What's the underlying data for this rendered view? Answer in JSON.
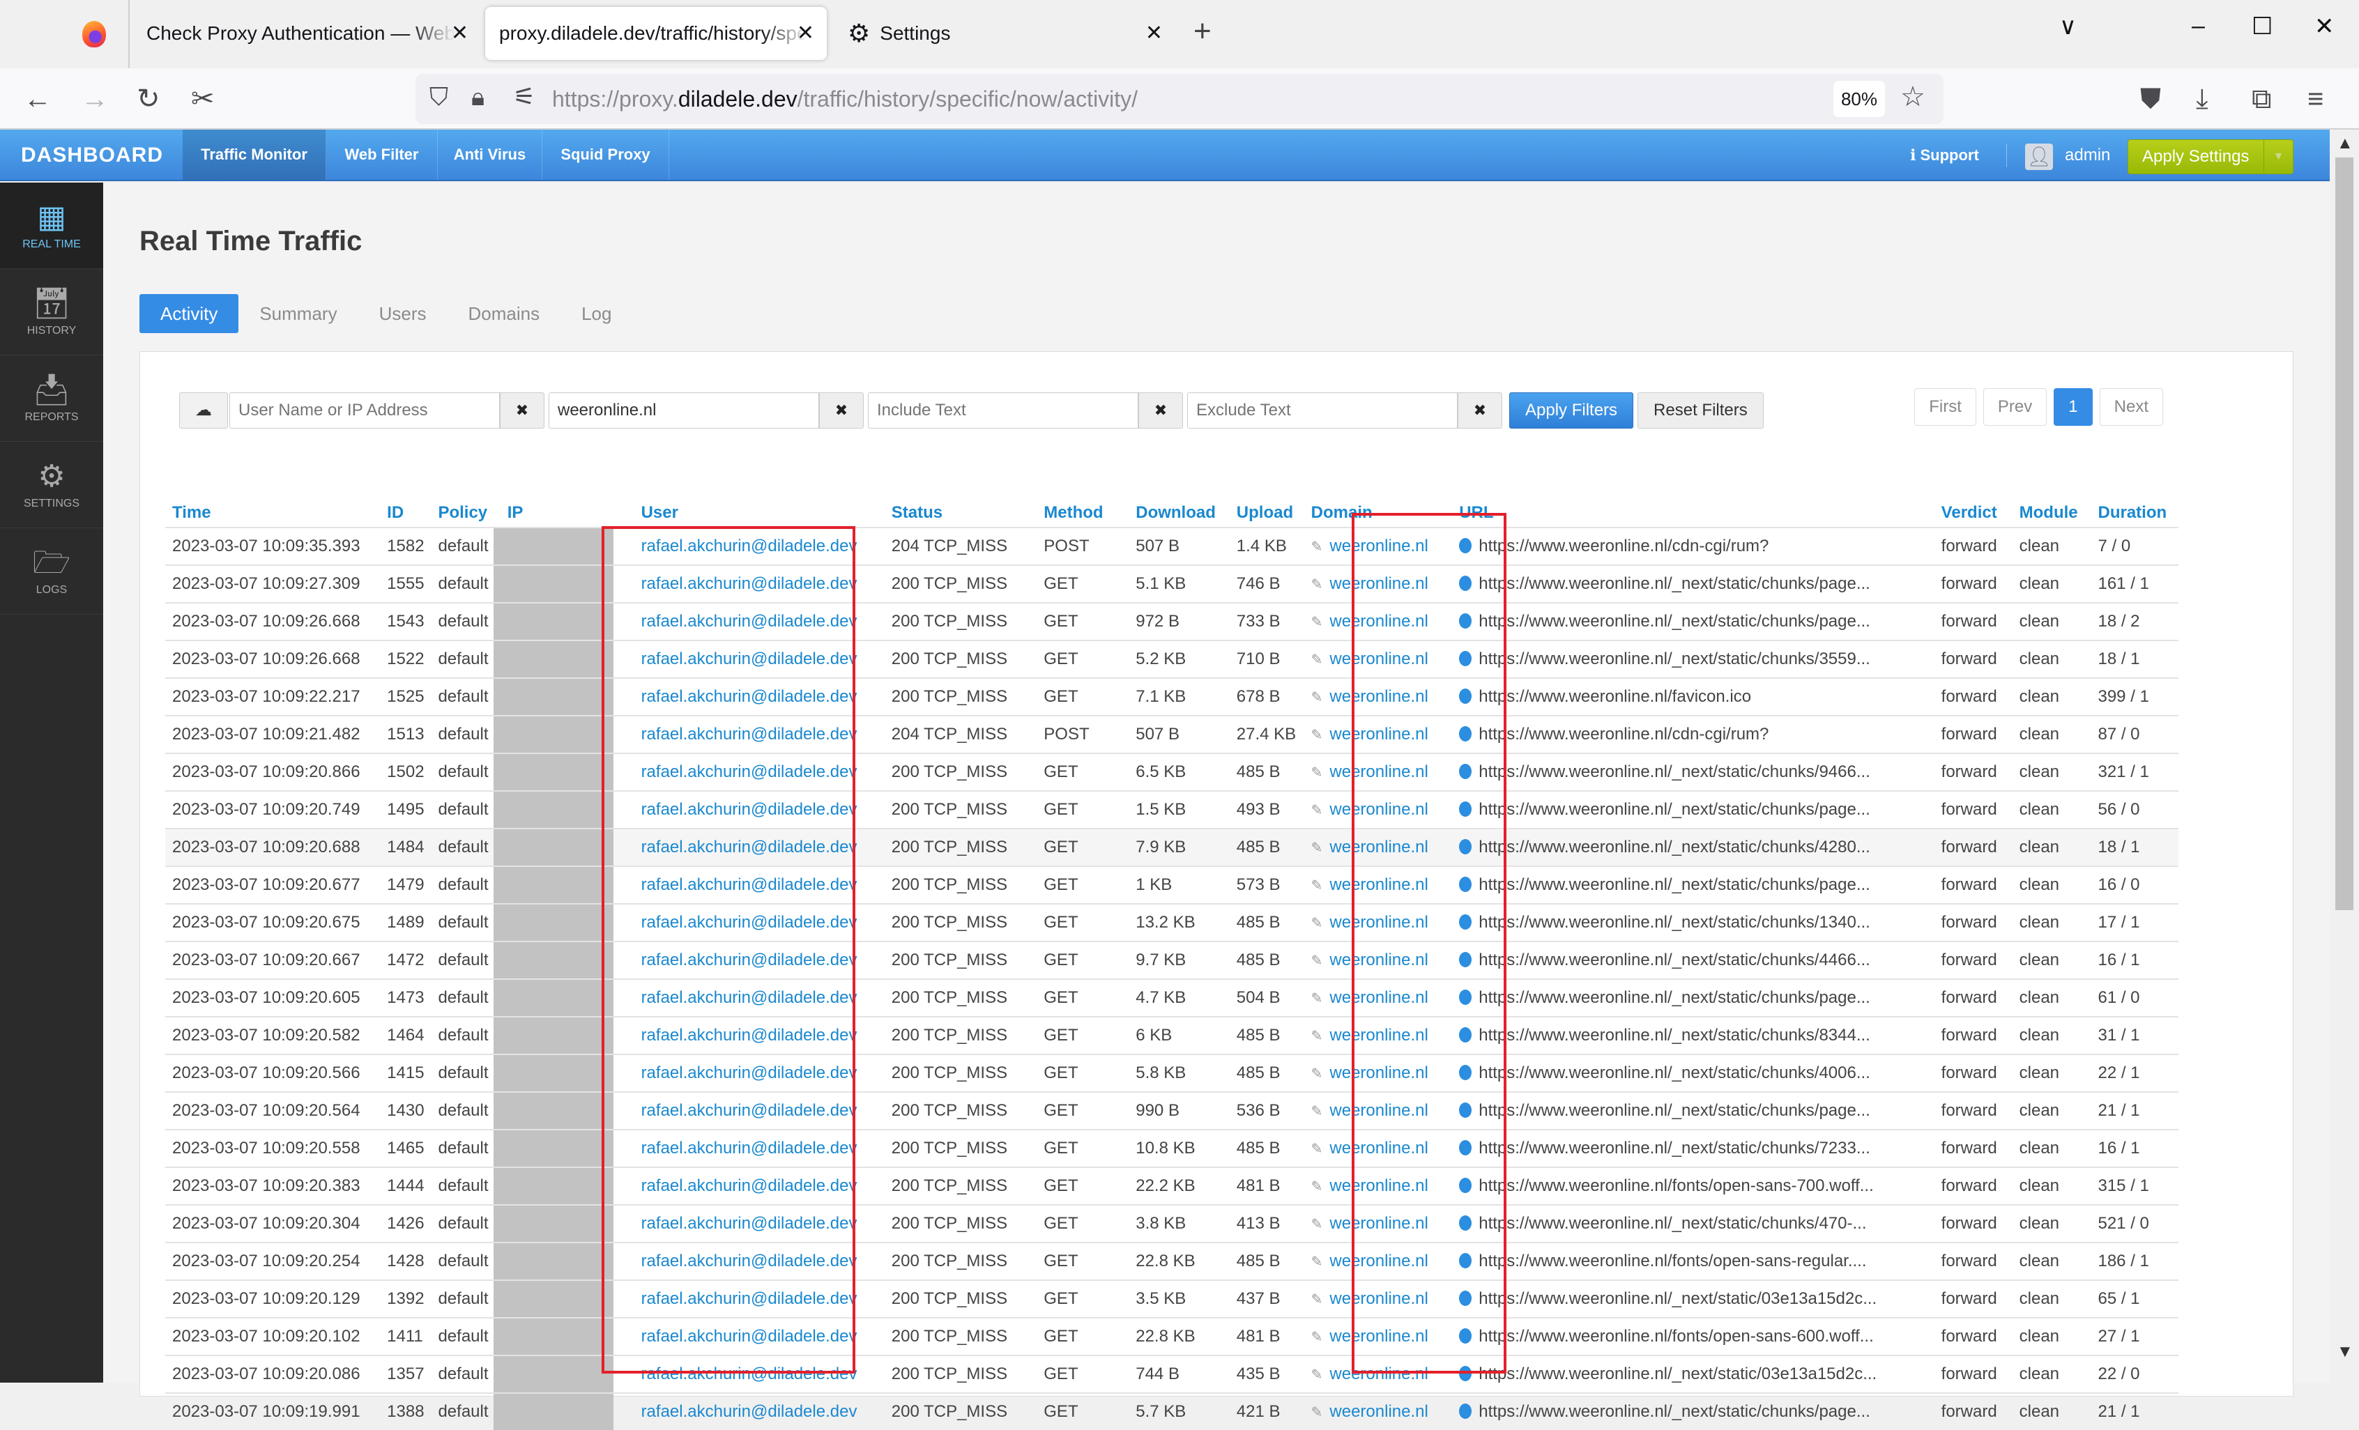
{
  "browser": {
    "tabs": [
      {
        "title": "Check Proxy Authentication — Web",
        "active": false
      },
      {
        "title": "proxy.diladele.dev/traffic/history/spe",
        "active": true
      },
      {
        "title": "Settings",
        "icon": "gear-icon",
        "active": false
      }
    ],
    "new_tab_label": "+",
    "url_prefix": "https://proxy.",
    "url_domain": "diladele.dev",
    "url_path": "/traffic/history/specific/now/activity/",
    "zoom": "80%",
    "window_controls": {
      "minimize": "–",
      "maximize": "☐",
      "close": "✕",
      "tab_list": "∨"
    }
  },
  "app": {
    "brand": "DASHBOARD",
    "nav": [
      {
        "label": "Traffic Monitor",
        "active": true
      },
      {
        "label": "Web Filter",
        "active": false
      },
      {
        "label": "Anti Virus",
        "active": false
      },
      {
        "label": "Squid Proxy",
        "active": false
      }
    ],
    "support_label": "Support",
    "user_label": "admin",
    "apply_settings_label": "Apply Settings"
  },
  "sidebar": {
    "items": [
      {
        "label": "REAL TIME",
        "icon": "grid-icon",
        "active": true
      },
      {
        "label": "HISTORY",
        "icon": "calendar-icon",
        "active": false
      },
      {
        "label": "REPORTS",
        "icon": "inbox-icon",
        "active": false
      },
      {
        "label": "SETTINGS",
        "icon": "gear-icon",
        "active": false
      },
      {
        "label": "LOGS",
        "icon": "folder-icon",
        "active": false
      }
    ]
  },
  "page": {
    "title": "Real Time Traffic",
    "tabs": [
      {
        "label": "Activity",
        "active": true
      },
      {
        "label": "Summary",
        "active": false
      },
      {
        "label": "Users",
        "active": false
      },
      {
        "label": "Domains",
        "active": false
      },
      {
        "label": "Log",
        "active": false
      }
    ]
  },
  "filters": {
    "user": {
      "value": "",
      "placeholder": "User Name or IP Address"
    },
    "domain": {
      "value": "weeronline.nl",
      "placeholder": ""
    },
    "include": {
      "value": "",
      "placeholder": "Include Text"
    },
    "exclude": {
      "value": "",
      "placeholder": "Exclude Text"
    },
    "clear_label": "✖",
    "apply_label": "Apply Filters",
    "reset_label": "Reset Filters"
  },
  "pagination": {
    "first": "First",
    "prev": "Prev",
    "current": "1",
    "next": "Next"
  },
  "table": {
    "columns": [
      "Time",
      "ID",
      "Policy",
      "IP",
      "User",
      "Status",
      "Method",
      "Download",
      "Upload",
      "Domain",
      "URL",
      "Verdict",
      "Module",
      "Duration"
    ],
    "rows": [
      {
        "time": "2023-03-07 10:09:35.393",
        "id": "1582",
        "policy": "default",
        "ip": "",
        "user": "rafael.akchurin@diladele.dev",
        "status": "204 TCP_MISS",
        "method": "POST",
        "download": "507 B",
        "upload": "1.4 KB",
        "domain": "weeronline.nl",
        "url": "https://www.weeronline.nl/cdn-cgi/rum?",
        "verdict": "forward",
        "module": "clean",
        "duration": "7 / 0"
      },
      {
        "time": "2023-03-07 10:09:27.309",
        "id": "1555",
        "policy": "default",
        "ip": "",
        "user": "rafael.akchurin@diladele.dev",
        "status": "200 TCP_MISS",
        "method": "GET",
        "download": "5.1 KB",
        "upload": "746 B",
        "domain": "weeronline.nl",
        "url": "https://www.weeronline.nl/_next/static/chunks/page...",
        "verdict": "forward",
        "module": "clean",
        "duration": "161 / 1"
      },
      {
        "time": "2023-03-07 10:09:26.668",
        "id": "1543",
        "policy": "default",
        "ip": "",
        "user": "rafael.akchurin@diladele.dev",
        "status": "200 TCP_MISS",
        "method": "GET",
        "download": "972 B",
        "upload": "733 B",
        "domain": "weeronline.nl",
        "url": "https://www.weeronline.nl/_next/static/chunks/page...",
        "verdict": "forward",
        "module": "clean",
        "duration": "18 / 2"
      },
      {
        "time": "2023-03-07 10:09:26.668",
        "id": "1522",
        "policy": "default",
        "ip": "",
        "user": "rafael.akchurin@diladele.dev",
        "status": "200 TCP_MISS",
        "method": "GET",
        "download": "5.2 KB",
        "upload": "710 B",
        "domain": "weeronline.nl",
        "url": "https://www.weeronline.nl/_next/static/chunks/3559...",
        "verdict": "forward",
        "module": "clean",
        "duration": "18 / 1"
      },
      {
        "time": "2023-03-07 10:09:22.217",
        "id": "1525",
        "policy": "default",
        "ip": "",
        "user": "rafael.akchurin@diladele.dev",
        "status": "200 TCP_MISS",
        "method": "GET",
        "download": "7.1 KB",
        "upload": "678 B",
        "domain": "weeronline.nl",
        "url": "https://www.weeronline.nl/favicon.ico",
        "verdict": "forward",
        "module": "clean",
        "duration": "399 / 1"
      },
      {
        "time": "2023-03-07 10:09:21.482",
        "id": "1513",
        "policy": "default",
        "ip": "",
        "user": "rafael.akchurin@diladele.dev",
        "status": "204 TCP_MISS",
        "method": "POST",
        "download": "507 B",
        "upload": "27.4 KB",
        "domain": "weeronline.nl",
        "url": "https://www.weeronline.nl/cdn-cgi/rum?",
        "verdict": "forward",
        "module": "clean",
        "duration": "87 / 0"
      },
      {
        "time": "2023-03-07 10:09:20.866",
        "id": "1502",
        "policy": "default",
        "ip": "",
        "user": "rafael.akchurin@diladele.dev",
        "status": "200 TCP_MISS",
        "method": "GET",
        "download": "6.5 KB",
        "upload": "485 B",
        "domain": "weeronline.nl",
        "url": "https://www.weeronline.nl/_next/static/chunks/9466...",
        "verdict": "forward",
        "module": "clean",
        "duration": "321 / 1"
      },
      {
        "time": "2023-03-07 10:09:20.749",
        "id": "1495",
        "policy": "default",
        "ip": "",
        "user": "rafael.akchurin@diladele.dev",
        "status": "200 TCP_MISS",
        "method": "GET",
        "download": "1.5 KB",
        "upload": "493 B",
        "domain": "weeronline.nl",
        "url": "https://www.weeronline.nl/_next/static/chunks/page...",
        "verdict": "forward",
        "module": "clean",
        "duration": "56 / 0"
      },
      {
        "time": "2023-03-07 10:09:20.688",
        "id": "1484",
        "policy": "default",
        "ip": "",
        "user": "rafael.akchurin@diladele.dev",
        "status": "200 TCP_MISS",
        "method": "GET",
        "download": "7.9 KB",
        "upload": "485 B",
        "domain": "weeronline.nl",
        "url": "https://www.weeronline.nl/_next/static/chunks/4280...",
        "verdict": "forward",
        "module": "clean",
        "duration": "18 / 1",
        "highlighted": true
      },
      {
        "time": "2023-03-07 10:09:20.677",
        "id": "1479",
        "policy": "default",
        "ip": "",
        "user": "rafael.akchurin@diladele.dev",
        "status": "200 TCP_MISS",
        "method": "GET",
        "download": "1 KB",
        "upload": "573 B",
        "domain": "weeronline.nl",
        "url": "https://www.weeronline.nl/_next/static/chunks/page...",
        "verdict": "forward",
        "module": "clean",
        "duration": "16 / 0"
      },
      {
        "time": "2023-03-07 10:09:20.675",
        "id": "1489",
        "policy": "default",
        "ip": "",
        "user": "rafael.akchurin@diladele.dev",
        "status": "200 TCP_MISS",
        "method": "GET",
        "download": "13.2 KB",
        "upload": "485 B",
        "domain": "weeronline.nl",
        "url": "https://www.weeronline.nl/_next/static/chunks/1340...",
        "verdict": "forward",
        "module": "clean",
        "duration": "17 / 1"
      },
      {
        "time": "2023-03-07 10:09:20.667",
        "id": "1472",
        "policy": "default",
        "ip": "",
        "user": "rafael.akchurin@diladele.dev",
        "status": "200 TCP_MISS",
        "method": "GET",
        "download": "9.7 KB",
        "upload": "485 B",
        "domain": "weeronline.nl",
        "url": "https://www.weeronline.nl/_next/static/chunks/4466...",
        "verdict": "forward",
        "module": "clean",
        "duration": "16 / 1"
      },
      {
        "time": "2023-03-07 10:09:20.605",
        "id": "1473",
        "policy": "default",
        "ip": "",
        "user": "rafael.akchurin@diladele.dev",
        "status": "200 TCP_MISS",
        "method": "GET",
        "download": "4.7 KB",
        "upload": "504 B",
        "domain": "weeronline.nl",
        "url": "https://www.weeronline.nl/_next/static/chunks/page...",
        "verdict": "forward",
        "module": "clean",
        "duration": "61 / 0"
      },
      {
        "time": "2023-03-07 10:09:20.582",
        "id": "1464",
        "policy": "default",
        "ip": "",
        "user": "rafael.akchurin@diladele.dev",
        "status": "200 TCP_MISS",
        "method": "GET",
        "download": "6 KB",
        "upload": "485 B",
        "domain": "weeronline.nl",
        "url": "https://www.weeronline.nl/_next/static/chunks/8344...",
        "verdict": "forward",
        "module": "clean",
        "duration": "31 / 1"
      },
      {
        "time": "2023-03-07 10:09:20.566",
        "id": "1415",
        "policy": "default",
        "ip": "",
        "user": "rafael.akchurin@diladele.dev",
        "status": "200 TCP_MISS",
        "method": "GET",
        "download": "5.8 KB",
        "upload": "485 B",
        "domain": "weeronline.nl",
        "url": "https://www.weeronline.nl/_next/static/chunks/4006...",
        "verdict": "forward",
        "module": "clean",
        "duration": "22 / 1"
      },
      {
        "time": "2023-03-07 10:09:20.564",
        "id": "1430",
        "policy": "default",
        "ip": "",
        "user": "rafael.akchurin@diladele.dev",
        "status": "200 TCP_MISS",
        "method": "GET",
        "download": "990 B",
        "upload": "536 B",
        "domain": "weeronline.nl",
        "url": "https://www.weeronline.nl/_next/static/chunks/page...",
        "verdict": "forward",
        "module": "clean",
        "duration": "21 / 1"
      },
      {
        "time": "2023-03-07 10:09:20.558",
        "id": "1465",
        "policy": "default",
        "ip": "",
        "user": "rafael.akchurin@diladele.dev",
        "status": "200 TCP_MISS",
        "method": "GET",
        "download": "10.8 KB",
        "upload": "485 B",
        "domain": "weeronline.nl",
        "url": "https://www.weeronline.nl/_next/static/chunks/7233...",
        "verdict": "forward",
        "module": "clean",
        "duration": "16 / 1"
      },
      {
        "time": "2023-03-07 10:09:20.383",
        "id": "1444",
        "policy": "default",
        "ip": "",
        "user": "rafael.akchurin@diladele.dev",
        "status": "200 TCP_MISS",
        "method": "GET",
        "download": "22.2 KB",
        "upload": "481 B",
        "domain": "weeronline.nl",
        "url": "https://www.weeronline.nl/fonts/open-sans-700.woff...",
        "verdict": "forward",
        "module": "clean",
        "duration": "315 / 1"
      },
      {
        "time": "2023-03-07 10:09:20.304",
        "id": "1426",
        "policy": "default",
        "ip": "",
        "user": "rafael.akchurin@diladele.dev",
        "status": "200 TCP_MISS",
        "method": "GET",
        "download": "3.8 KB",
        "upload": "413 B",
        "domain": "weeronline.nl",
        "url": "https://www.weeronline.nl/_next/static/chunks/470-...",
        "verdict": "forward",
        "module": "clean",
        "duration": "521 / 0"
      },
      {
        "time": "2023-03-07 10:09:20.254",
        "id": "1428",
        "policy": "default",
        "ip": "",
        "user": "rafael.akchurin@diladele.dev",
        "status": "200 TCP_MISS",
        "method": "GET",
        "download": "22.8 KB",
        "upload": "485 B",
        "domain": "weeronline.nl",
        "url": "https://www.weeronline.nl/fonts/open-sans-regular....",
        "verdict": "forward",
        "module": "clean",
        "duration": "186 / 1"
      },
      {
        "time": "2023-03-07 10:09:20.129",
        "id": "1392",
        "policy": "default",
        "ip": "",
        "user": "rafael.akchurin@diladele.dev",
        "status": "200 TCP_MISS",
        "method": "GET",
        "download": "3.5 KB",
        "upload": "437 B",
        "domain": "weeronline.nl",
        "url": "https://www.weeronline.nl/_next/static/03e13a15d2c...",
        "verdict": "forward",
        "module": "clean",
        "duration": "65 / 1"
      },
      {
        "time": "2023-03-07 10:09:20.102",
        "id": "1411",
        "policy": "default",
        "ip": "",
        "user": "rafael.akchurin@diladele.dev",
        "status": "200 TCP_MISS",
        "method": "GET",
        "download": "22.8 KB",
        "upload": "481 B",
        "domain": "weeronline.nl",
        "url": "https://www.weeronline.nl/fonts/open-sans-600.woff...",
        "verdict": "forward",
        "module": "clean",
        "duration": "27 / 1"
      },
      {
        "time": "2023-03-07 10:09:20.086",
        "id": "1357",
        "policy": "default",
        "ip": "",
        "user": "rafael.akchurin@diladele.dev",
        "status": "200 TCP_MISS",
        "method": "GET",
        "download": "744 B",
        "upload": "435 B",
        "domain": "weeronline.nl",
        "url": "https://www.weeronline.nl/_next/static/03e13a15d2c...",
        "verdict": "forward",
        "module": "clean",
        "duration": "22 / 0"
      },
      {
        "time": "2023-03-07 10:09:19.991",
        "id": "1388",
        "policy": "default",
        "ip": "",
        "user": "rafael.akchurin@diladele.dev",
        "status": "200 TCP_MISS",
        "method": "GET",
        "download": "5.7 KB",
        "upload": "421 B",
        "domain": "weeronline.nl",
        "url": "https://www.weeronline.nl/_next/static/chunks/page...",
        "verdict": "forward",
        "module": "clean",
        "duration": "21 / 1"
      }
    ]
  },
  "colors": {
    "accent": "#348ce5",
    "link": "#1a88cf",
    "nav_bar": "#4a9be6",
    "apply_settings": "#a8c40e",
    "highlight_box": "#e3202c",
    "sidebar": "#2b2b2b"
  }
}
